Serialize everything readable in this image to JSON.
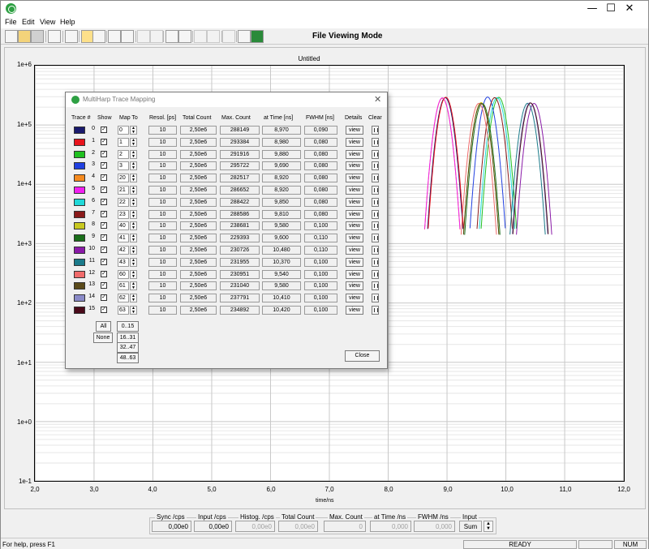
{
  "window": {
    "title": "",
    "minimize": "—",
    "maximize": "☐",
    "close": "✕"
  },
  "menu": [
    "File",
    "Edit",
    "View",
    "Help"
  ],
  "toolbar": {
    "mode_label": "File Viewing Mode"
  },
  "plot": {
    "title": "Untitled",
    "xlabel": "time/ns",
    "yticks": [
      "1e+6",
      "1e+5",
      "1e+4",
      "1e+3",
      "1e+2",
      "1e+1",
      "1e+0",
      "1e-1"
    ],
    "xticks": [
      "2,0",
      "3,0",
      "4,0",
      "5,0",
      "6,0",
      "7,0",
      "8,0",
      "9,0",
      "10,0",
      "11,0",
      "12,0"
    ]
  },
  "chart_data": {
    "type": "line",
    "title": "Untitled",
    "xlabel": "time/ns",
    "ylabel": "",
    "xlim": [
      2.0,
      12.0
    ],
    "ylim": [
      0.1,
      1000000
    ],
    "yscale": "log",
    "grid": true,
    "series": [
      {
        "name": "0",
        "peak_time_ns": 8.97,
        "max_count": 288149,
        "fwhm_ns": 0.09,
        "color": "#1a1a6e"
      },
      {
        "name": "1",
        "peak_time_ns": 8.98,
        "max_count": 293384,
        "fwhm_ns": 0.08,
        "color": "#e8141c"
      },
      {
        "name": "2",
        "peak_time_ns": 9.88,
        "max_count": 291916,
        "fwhm_ns": 0.08,
        "color": "#20c020"
      },
      {
        "name": "3",
        "peak_time_ns": 9.69,
        "max_count": 295722,
        "fwhm_ns": 0.08,
        "color": "#2040e0"
      },
      {
        "name": "4",
        "peak_time_ns": 8.92,
        "max_count": 282517,
        "fwhm_ns": 0.08,
        "color": "#f58a1f"
      },
      {
        "name": "5",
        "peak_time_ns": 8.92,
        "max_count": 286652,
        "fwhm_ns": 0.08,
        "color": "#f020f0"
      },
      {
        "name": "6",
        "peak_time_ns": 9.85,
        "max_count": 288422,
        "fwhm_ns": 0.08,
        "color": "#20d8d8"
      },
      {
        "name": "7",
        "peak_time_ns": 9.81,
        "max_count": 288586,
        "fwhm_ns": 0.08,
        "color": "#8a1a1a"
      },
      {
        "name": "8",
        "peak_time_ns": 9.58,
        "max_count": 238681,
        "fwhm_ns": 0.1,
        "color": "#c8c820"
      },
      {
        "name": "9",
        "peak_time_ns": 9.6,
        "max_count": 229393,
        "fwhm_ns": 0.11,
        "color": "#1a6e1a"
      },
      {
        "name": "10",
        "peak_time_ns": 10.48,
        "max_count": 230726,
        "fwhm_ns": 0.11,
        "color": "#8a1aa8"
      },
      {
        "name": "11",
        "peak_time_ns": 10.37,
        "max_count": 231955,
        "fwhm_ns": 0.1,
        "color": "#1a7a8a"
      },
      {
        "name": "12",
        "peak_time_ns": 9.54,
        "max_count": 230951,
        "fwhm_ns": 0.1,
        "color": "#f06a6a"
      },
      {
        "name": "13",
        "peak_time_ns": 9.58,
        "max_count": 231040,
        "fwhm_ns": 0.1,
        "color": "#5a4a1a"
      },
      {
        "name": "14",
        "peak_time_ns": 10.41,
        "max_count": 237791,
        "fwhm_ns": 0.1,
        "color": "#8a8ac8"
      },
      {
        "name": "15",
        "peak_time_ns": 10.42,
        "max_count": 234892,
        "fwhm_ns": 0.1,
        "color": "#4a0a1a"
      }
    ]
  },
  "dialog": {
    "title": "MultiHarp Trace Mapping",
    "close": "✕",
    "headers": {
      "trace": "Trace #",
      "show": "Show",
      "map": "Map To",
      "resol": "Resol. [ps]",
      "total": "Total Count",
      "max": "Max. Count",
      "attime": "at Time [ns]",
      "fwhm": "FWHM [ns]",
      "details": "Details",
      "clear": "Clear"
    },
    "rows": [
      {
        "n": "0",
        "color": "#1a1a6e",
        "show": true,
        "map": "0",
        "resol": "10",
        "total": "2,50e6",
        "max": "288149",
        "at": "8,970",
        "fwhm": "0,090",
        "view": "view"
      },
      {
        "n": "1",
        "color": "#e8141c",
        "show": true,
        "map": "1",
        "resol": "10",
        "total": "2,50e6",
        "max": "293384",
        "at": "8,980",
        "fwhm": "0,080",
        "view": "view"
      },
      {
        "n": "2",
        "color": "#20c020",
        "show": true,
        "map": "2",
        "resol": "10",
        "total": "2,50e6",
        "max": "291916",
        "at": "9,880",
        "fwhm": "0,080",
        "view": "view"
      },
      {
        "n": "3",
        "color": "#2040e0",
        "show": true,
        "map": "3",
        "resol": "10",
        "total": "2,50e6",
        "max": "295722",
        "at": "9,690",
        "fwhm": "0,080",
        "view": "view"
      },
      {
        "n": "4",
        "color": "#f58a1f",
        "show": true,
        "map": "20",
        "resol": "10",
        "total": "2,50e6",
        "max": "282517",
        "at": "8,920",
        "fwhm": "0,080",
        "view": "view"
      },
      {
        "n": "5",
        "color": "#f020f0",
        "show": true,
        "map": "21",
        "resol": "10",
        "total": "2,50e6",
        "max": "286652",
        "at": "8,920",
        "fwhm": "0,080",
        "view": "view"
      },
      {
        "n": "6",
        "color": "#20d8d8",
        "show": true,
        "map": "22",
        "resol": "10",
        "total": "2,50e6",
        "max": "288422",
        "at": "9,850",
        "fwhm": "0,080",
        "view": "view"
      },
      {
        "n": "7",
        "color": "#8a1a1a",
        "show": true,
        "map": "23",
        "resol": "10",
        "total": "2,50e6",
        "max": "288586",
        "at": "9,810",
        "fwhm": "0,080",
        "view": "view"
      },
      {
        "n": "8",
        "color": "#c8c820",
        "show": true,
        "map": "40",
        "resol": "10",
        "total": "2,50e6",
        "max": "238681",
        "at": "9,580",
        "fwhm": "0,100",
        "view": "view"
      },
      {
        "n": "9",
        "color": "#1a6e1a",
        "show": true,
        "map": "41",
        "resol": "10",
        "total": "2,50e6",
        "max": "229393",
        "at": "9,600",
        "fwhm": "0,110",
        "view": "view"
      },
      {
        "n": "10",
        "color": "#8a1aa8",
        "show": true,
        "map": "42",
        "resol": "10",
        "total": "2,50e6",
        "max": "230726",
        "at": "10,480",
        "fwhm": "0,110",
        "view": "view"
      },
      {
        "n": "11",
        "color": "#1a7a8a",
        "show": true,
        "map": "43",
        "resol": "10",
        "total": "2,50e6",
        "max": "231955",
        "at": "10,370",
        "fwhm": "0,100",
        "view": "view"
      },
      {
        "n": "12",
        "color": "#f06a6a",
        "show": true,
        "map": "60",
        "resol": "10",
        "total": "2,50e6",
        "max": "230951",
        "at": "9,540",
        "fwhm": "0,100",
        "view": "view"
      },
      {
        "n": "13",
        "color": "#5a4a1a",
        "show": true,
        "map": "61",
        "resol": "10",
        "total": "2,50e6",
        "max": "231040",
        "at": "9,580",
        "fwhm": "0,100",
        "view": "view"
      },
      {
        "n": "14",
        "color": "#8a8ac8",
        "show": true,
        "map": "62",
        "resol": "10",
        "total": "2,50e6",
        "max": "237791",
        "at": "10,410",
        "fwhm": "0,100",
        "view": "view"
      },
      {
        "n": "15",
        "color": "#4a0a1a",
        "show": true,
        "map": "63",
        "resol": "10",
        "total": "2,50e6",
        "max": "234892",
        "at": "10,420",
        "fwhm": "0,100",
        "view": "view"
      }
    ],
    "all_label": "All",
    "none_label": "None",
    "range_buttons": [
      "0..15",
      "16..31",
      "32..47",
      "48..63"
    ],
    "close_label": "Close"
  },
  "status": {
    "sync_label": "Sync /cps",
    "sync_value": "0,00e0",
    "input_label": "Input /cps",
    "input_value": "0,00e0",
    "histog_label": "Histog. /cps",
    "histog_value": "0,00e0",
    "total_label": "Total Count",
    "total_value": "0,00e0",
    "max_label": "Max. Count",
    "max_value": "0",
    "attime_label": "at Time /ns",
    "attime_value": "0,000",
    "fwhm_label": "FWHM  /ns",
    "fwhm_value": "0,000",
    "input2_label": "Input",
    "input2_value": "Sum"
  },
  "statusbar": {
    "help": "For help, press F1",
    "ready": "READY",
    "num": "NUM"
  }
}
